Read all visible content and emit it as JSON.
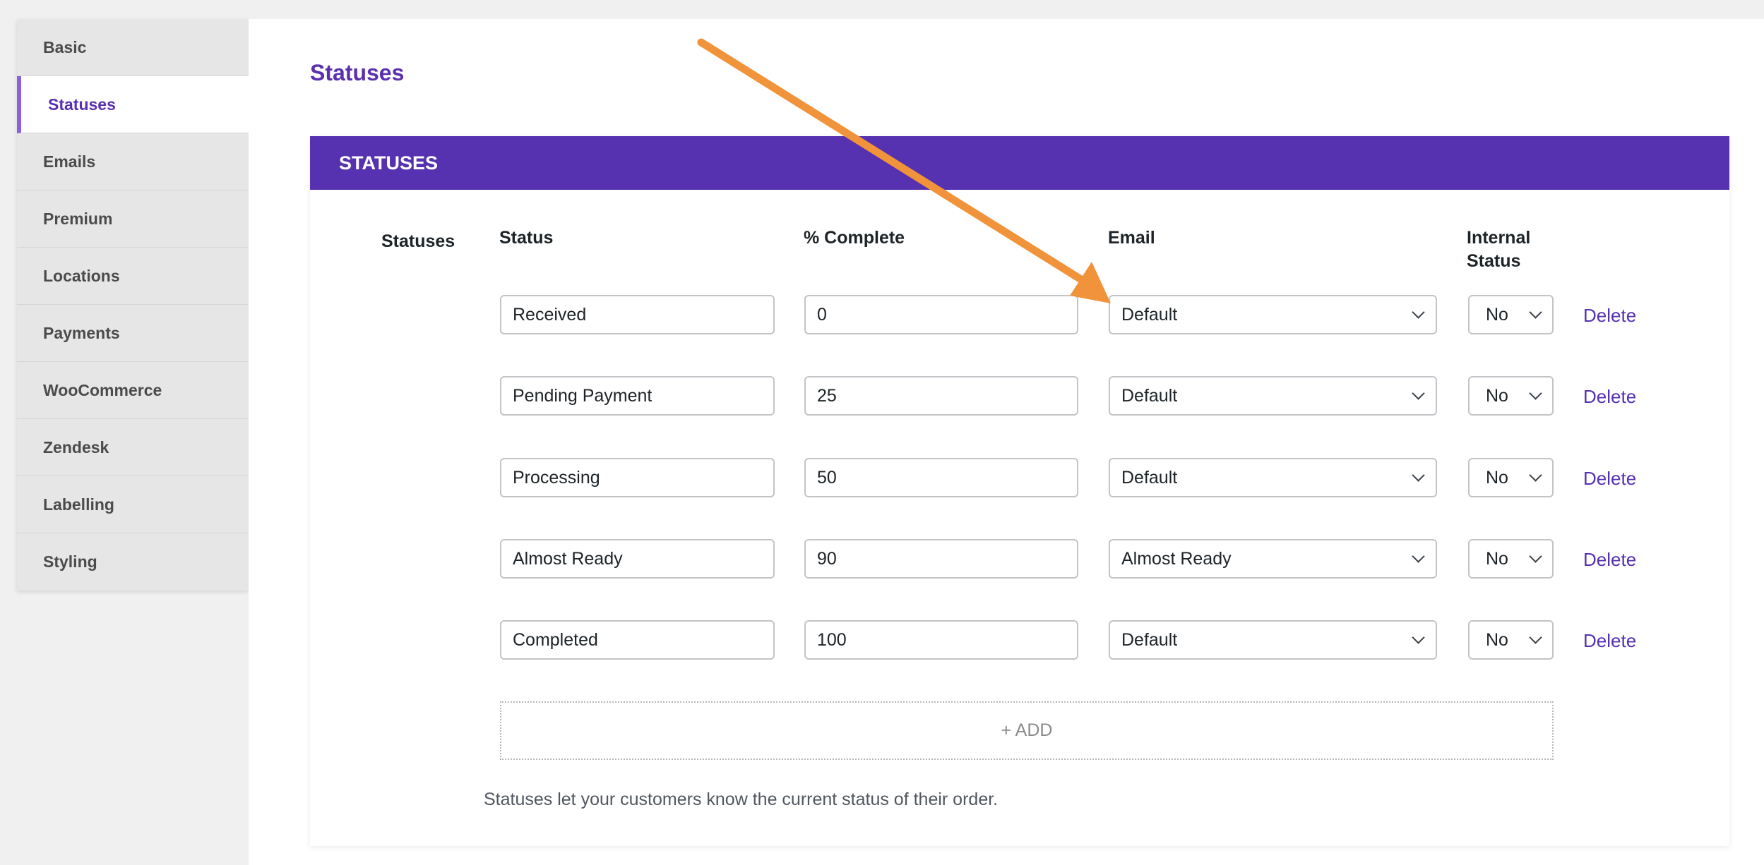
{
  "sidebar": {
    "items": [
      {
        "label": "Basic"
      },
      {
        "label": "Statuses"
      },
      {
        "label": "Emails"
      },
      {
        "label": "Premium"
      },
      {
        "label": "Locations"
      },
      {
        "label": "Payments"
      },
      {
        "label": "WooCommerce"
      },
      {
        "label": "Zendesk"
      },
      {
        "label": "Labelling"
      },
      {
        "label": "Styling"
      }
    ],
    "active_index": 1
  },
  "page": {
    "title": "Statuses"
  },
  "panel": {
    "header": "STATUSES",
    "field_label": "Statuses",
    "columns": {
      "status": "Status",
      "complete": "% Complete",
      "email": "Email",
      "internal": "Internal Status"
    },
    "rows": [
      {
        "status": "Received",
        "complete": "0",
        "email": "Default",
        "internal": "No",
        "delete": "Delete"
      },
      {
        "status": "Pending Payment",
        "complete": "25",
        "email": "Default",
        "internal": "No",
        "delete": "Delete"
      },
      {
        "status": "Processing",
        "complete": "50",
        "email": "Default",
        "internal": "No",
        "delete": "Delete"
      },
      {
        "status": "Almost Ready",
        "complete": "90",
        "email": "Almost Ready",
        "internal": "No",
        "delete": "Delete"
      },
      {
        "status": "Completed",
        "complete": "100",
        "email": "Default",
        "internal": "No",
        "delete": "Delete"
      }
    ],
    "add_label": "+ ADD",
    "description": "Statuses let your customers know the current status of their order."
  },
  "colors": {
    "accent": "#5631b0",
    "arrow": "#f0933a",
    "sidebar_active_bar": "#8a5fe0"
  },
  "icons": {
    "dropdown": "chevron-down-icon",
    "annotation": "arrow-annotation"
  }
}
